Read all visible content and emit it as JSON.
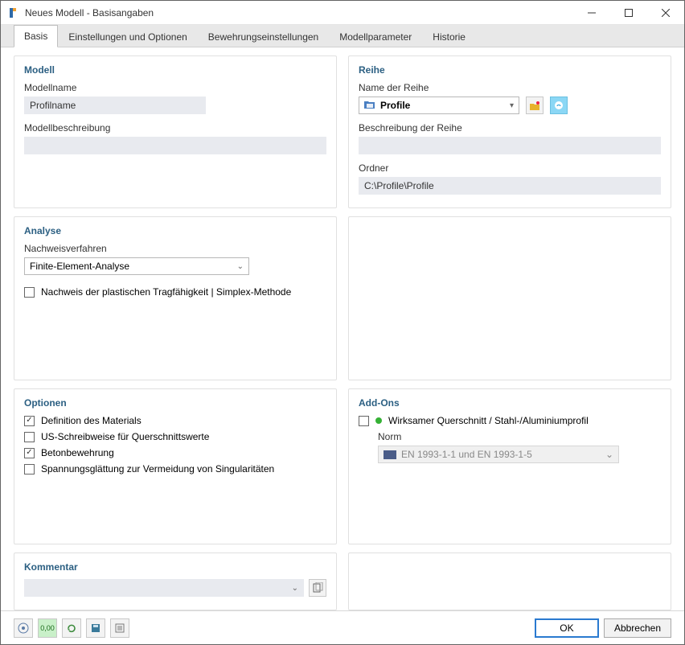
{
  "window": {
    "title": "Neues Modell - Basisangaben"
  },
  "tabs": [
    {
      "label": "Basis",
      "active": true
    },
    {
      "label": "Einstellungen und Optionen",
      "active": false
    },
    {
      "label": "Bewehrungseinstellungen",
      "active": false
    },
    {
      "label": "Modellparameter",
      "active": false
    },
    {
      "label": "Historie",
      "active": false
    }
  ],
  "model": {
    "title": "Modell",
    "name_label": "Modellname",
    "name_value": "Profilname",
    "desc_label": "Modellbeschreibung",
    "desc_value": ""
  },
  "series": {
    "title": "Reihe",
    "name_label": "Name der Reihe",
    "selected": "Profile",
    "desc_label": "Beschreibung der Reihe",
    "desc_value": "",
    "folder_label": "Ordner",
    "folder_value": "C:\\Profile\\Profile"
  },
  "analysis": {
    "title": "Analyse",
    "method_label": "Nachweisverfahren",
    "method_value": "Finite-Element-Analyse",
    "plastic_label": "Nachweis der plastischen Tragfähigkeit | Simplex-Methode",
    "plastic_checked": false
  },
  "options": {
    "title": "Optionen",
    "items": [
      {
        "label": "Definition des Materials",
        "checked": true
      },
      {
        "label": "US-Schreibweise für Querschnittswerte",
        "checked": false
      },
      {
        "label": "Betonbewehrung",
        "checked": true
      },
      {
        "label": "Spannungsglättung zur Vermeidung von Singularitäten",
        "checked": false
      }
    ]
  },
  "addons": {
    "title": "Add-Ons",
    "effective_label": "Wirksamer Querschnitt / Stahl-/Aluminiumprofil",
    "effective_checked": false,
    "norm_label": "Norm",
    "norm_value": "EN 1993-1-1 und EN 1993-1-5"
  },
  "comment": {
    "title": "Kommentar",
    "value": ""
  },
  "footer": {
    "ok": "OK",
    "cancel": "Abbrechen"
  }
}
